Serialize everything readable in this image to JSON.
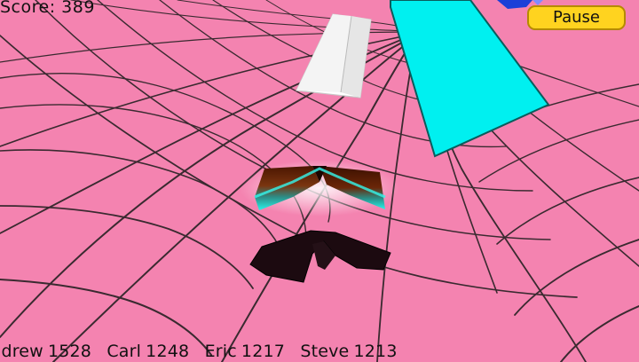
{
  "hud": {
    "score_label": "Score:",
    "score_value": "389"
  },
  "pause_button": {
    "label": "Pause"
  },
  "leaderboard": [
    {
      "name": "Andrew",
      "score": "1528"
    },
    {
      "name": "Carl",
      "score": "1248"
    },
    {
      "name": "Eric",
      "score": "1217"
    },
    {
      "name": "Steve",
      "score": "1213"
    }
  ],
  "colors": {
    "tunnel": "#f483b0",
    "grid_lines": "#3a2a30",
    "obstacle_white": "#ffffff",
    "obstacle_cyan": "#00f0f0",
    "ship_top": "#5a1e00",
    "ship_glow": "#29f2e6",
    "shadow": "#1c0a10",
    "pause_button": "#ffd31f"
  }
}
